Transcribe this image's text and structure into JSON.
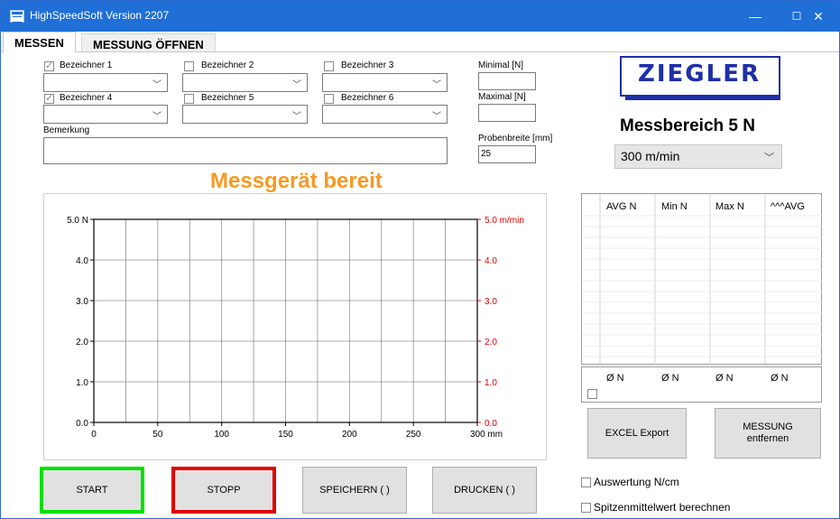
{
  "window": {
    "title": "HighSpeedSoft Version 2207",
    "min": "—",
    "max": "☐",
    "close": "✕"
  },
  "tabs": [
    "MESSEN",
    "MESSUNG ÖFFNEN"
  ],
  "designators": [
    {
      "label": "Bezeichner 1",
      "checked": true
    },
    {
      "label": "Bezeichner 2",
      "checked": false
    },
    {
      "label": "Bezeichner 3",
      "checked": false
    },
    {
      "label": "Bezeichner 4",
      "checked": true
    },
    {
      "label": "Bezeichner 5",
      "checked": false
    },
    {
      "label": "Bezeichner 6",
      "checked": false
    }
  ],
  "remark": {
    "label": "Bemerkung",
    "value": ""
  },
  "limits": {
    "min_label": "Minimal [N]",
    "min_value": "",
    "max_label": "Maximal [N]",
    "max_value": ""
  },
  "sample": {
    "label": "Probenbreite [mm]",
    "value": "25"
  },
  "logo": {
    "text": "ZIEGLER",
    "color": "#1f2fa8"
  },
  "range": {
    "label": "Messbereich 5 N",
    "speed": "300 m/min"
  },
  "status": {
    "text": "Messgerät bereit",
    "color": "#f59a23"
  },
  "chart_data": {
    "type": "line",
    "x_ticks": [
      "0",
      "50",
      "100",
      "150",
      "200",
      "250",
      "300 mm"
    ],
    "y_left_ticks": [
      "0.0",
      "1.0",
      "2.0",
      "3.0",
      "4.0",
      "5.0 N"
    ],
    "y_right_ticks": [
      "0.0",
      "1.0",
      "2.0",
      "3.0",
      "4.0",
      "5.0 m/min"
    ],
    "xlim": [
      0,
      300
    ],
    "ylim": [
      0,
      5
    ],
    "right_axis_color": "#e00000",
    "grid": true,
    "series": []
  },
  "results": {
    "headers": [
      "AVG N",
      "Min N",
      "Max N",
      "^^^AVG"
    ],
    "averages": [
      "Ø N",
      "Ø N",
      "Ø N",
      "Ø N"
    ]
  },
  "buttons": {
    "start": "START",
    "stopp": "STOPP",
    "speichern": "SPEICHERN ( )",
    "drucken": "DRUCKEN ( )",
    "excel": "EXCEL Export",
    "remove_line1": "MESSUNG",
    "remove_line2": "entfernen"
  },
  "options": {
    "auswertung": "Auswertung N/cm",
    "spitzen": "Spitzenmittelwert berechnen"
  }
}
